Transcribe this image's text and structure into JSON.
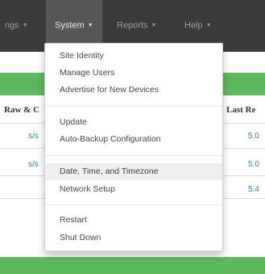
{
  "navbar": {
    "items": [
      {
        "label": "ngs",
        "has_caret": true
      },
      {
        "label": "System",
        "has_caret": true,
        "active": true
      },
      {
        "label": "Reports",
        "has_caret": true
      },
      {
        "label": "Help",
        "has_caret": true
      }
    ],
    "caret_glyph": "▼"
  },
  "table": {
    "headers": [
      "Raw & C",
      "Last Re"
    ],
    "rows": [
      {
        "col1": "s/s",
        "col2": "5.0"
      },
      {
        "col1": "s/s",
        "col2": "5.0"
      },
      {
        "col1": "",
        "col2": "5.4"
      }
    ]
  },
  "dropdown": {
    "groups": [
      [
        "Site Identity",
        "Manage Users",
        "Advertise for New Devices"
      ],
      [
        "Update",
        "Auto-Backup Configuration"
      ],
      [
        "Date, Time, and Timezone",
        "Network Setup"
      ],
      [
        "Restart",
        "Shut Down"
      ]
    ],
    "highlighted": "Date, Time, and Timezone"
  },
  "colors": {
    "navbar": "#3b3b3b",
    "accent_green": "#5cb85c",
    "link": "#337ab7"
  }
}
